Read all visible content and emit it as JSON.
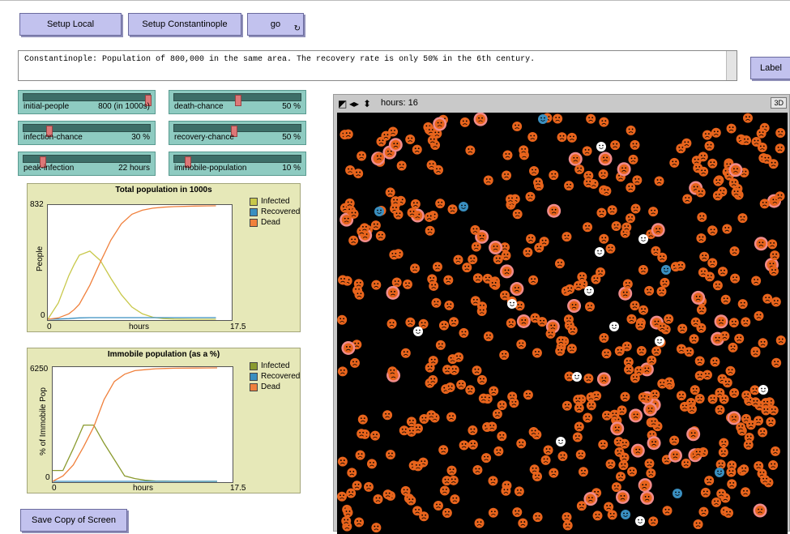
{
  "buttons": {
    "setup_local": "Setup Local",
    "setup_constantinople": "Setup Constantinople",
    "go": "go",
    "go_forever_icon": "loop-arrows-icon",
    "label": "Label",
    "save": "Save Copy of Screen"
  },
  "note": "Constantinople: Population of 800,000 in the same area. The recovery rate is only 50% in the 6th century.",
  "sliders": [
    {
      "name": "initial-people",
      "value": "800 (in 1000s)",
      "level": 0.98
    },
    {
      "name": "death-chance",
      "value": "50 %",
      "level": 0.5
    },
    {
      "name": "infection-chance",
      "value": "30 %",
      "level": 0.2
    },
    {
      "name": "recovery-chance",
      "value": "50 %",
      "level": 0.47
    },
    {
      "name": "peak-infection",
      "value": "22 hours",
      "level": 0.15
    },
    {
      "name": "immobile-population",
      "value": "10 %",
      "level": 0.1
    }
  ],
  "plot1": {
    "title": "Total population in 1000s",
    "ylabel": "People",
    "xlabel": "hours",
    "xmin": "0",
    "xmax": "17.5",
    "ymin": "0",
    "ymax": "832"
  },
  "plot2": {
    "title": "Immobile population (as a %)",
    "ylabel": "% of Immobile Pop",
    "xlabel": "hours",
    "xmin": "0",
    "xmax": "17.5",
    "ymin": "0",
    "ymax": "6250"
  },
  "legend": [
    "Infected",
    "Recovered",
    "Dead"
  ],
  "colors": {
    "infected1": "#c8c84a",
    "infected2": "#8a9a2e",
    "recovered": "#3a8fc0",
    "dead": "#f0803c"
  },
  "view": {
    "hours_label": "hours: 16",
    "threed": "3D"
  },
  "chart_data": [
    {
      "type": "line",
      "title": "Total population in 1000s",
      "xlabel": "hours",
      "ylabel": "People",
      "xlim": [
        0,
        17.5
      ],
      "ylim": [
        0,
        832
      ],
      "x": [
        0,
        1,
        2,
        2.5,
        3,
        4,
        5,
        6,
        7,
        8,
        9,
        10,
        11,
        12,
        14,
        16
      ],
      "series": [
        {
          "name": "Infected",
          "values": [
            0,
            120,
            320,
            400,
            470,
            500,
            430,
            300,
            180,
            90,
            40,
            15,
            5,
            2,
            0,
            0
          ]
        },
        {
          "name": "Recovered",
          "values": [
            0,
            2,
            5,
            8,
            10,
            12,
            12,
            12,
            12,
            12,
            12,
            12,
            12,
            12,
            12,
            12
          ]
        },
        {
          "name": "Dead",
          "values": [
            0,
            10,
            40,
            70,
            110,
            250,
            420,
            580,
            700,
            770,
            800,
            815,
            822,
            826,
            830,
            832
          ]
        }
      ]
    },
    {
      "type": "line",
      "title": "Immobile population (as a %)",
      "xlabel": "hours",
      "ylabel": "% of Immobile Pop",
      "xlim": [
        0,
        17.5
      ],
      "ylim": [
        0,
        6250
      ],
      "x": [
        0,
        1,
        2,
        3,
        4,
        5,
        6,
        7,
        8,
        9,
        10,
        11,
        12,
        14,
        16
      ],
      "series": [
        {
          "name": "Infected",
          "values": [
            600,
            600,
            1800,
            3100,
            3100,
            2100,
            1200,
            300,
            150,
            60,
            20,
            10,
            0,
            0,
            0
          ]
        },
        {
          "name": "Recovered",
          "values": [
            0,
            0,
            0,
            0,
            0,
            0,
            0,
            0,
            0,
            0,
            0,
            0,
            0,
            0,
            0
          ]
        },
        {
          "name": "Dead",
          "values": [
            0,
            300,
            900,
            1900,
            3000,
            4500,
            5500,
            5900,
            6100,
            6150,
            6200,
            6220,
            6230,
            6240,
            6250
          ]
        }
      ]
    }
  ]
}
